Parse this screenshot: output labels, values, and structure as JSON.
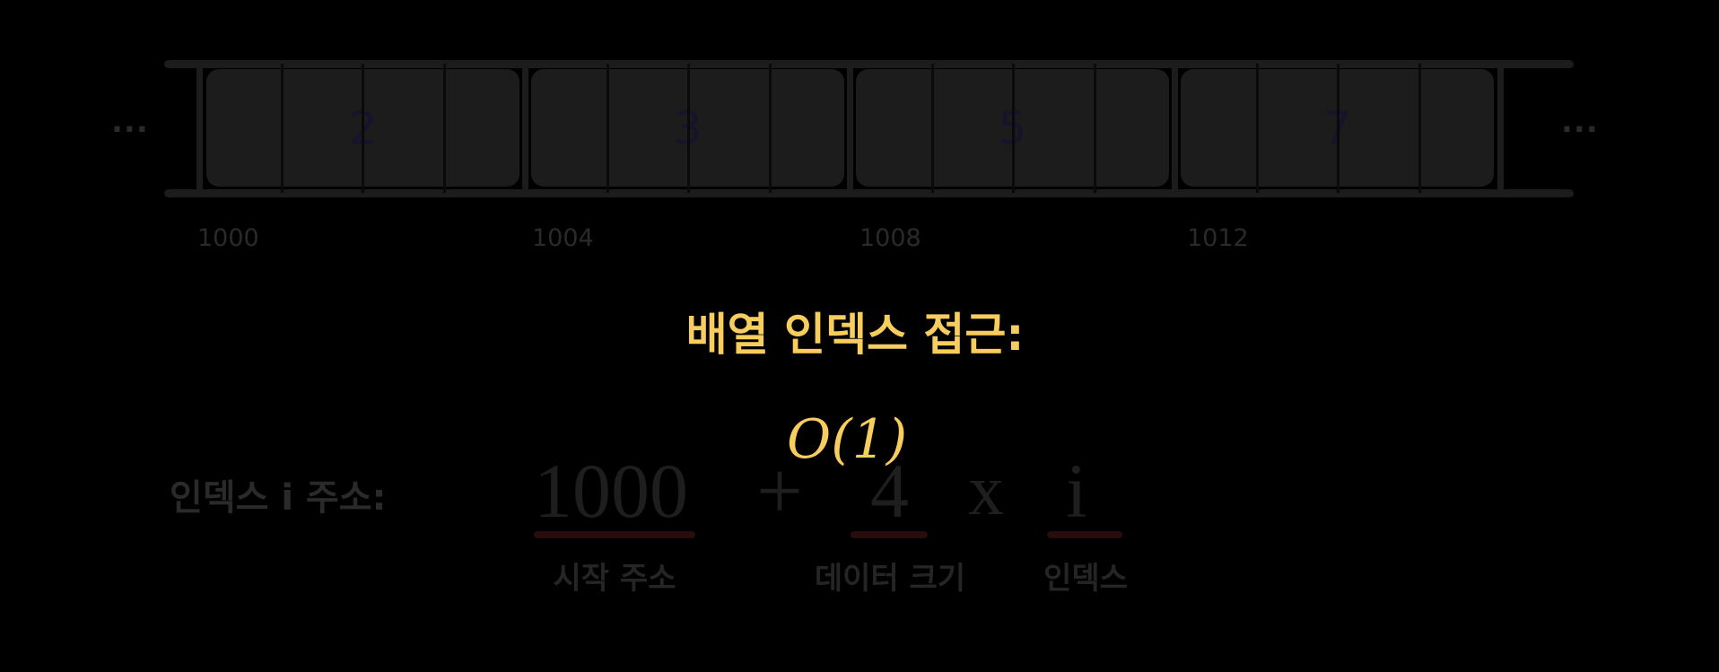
{
  "memory": {
    "cells": [
      {
        "value": "2",
        "address": "1000"
      },
      {
        "value": "3",
        "address": "1004"
      },
      {
        "value": "5",
        "address": "1008"
      },
      {
        "value": "7",
        "address": "1012"
      }
    ],
    "left_ellipsis": "...",
    "right_ellipsis": "..."
  },
  "title": "배열 인덱스 접근:",
  "complexity": "O(1)",
  "formula": {
    "label": "인덱스 i 주소:",
    "start": "1000",
    "plus": "+",
    "size": "4",
    "times": "x",
    "index": "i",
    "start_caption": "시작 주소",
    "size_caption": "데이터 크기",
    "index_caption": "인덱스"
  },
  "colors": {
    "accent": "#f7cd5e",
    "underline": "#2a0c0c",
    "cell": "#1c1c1c"
  }
}
